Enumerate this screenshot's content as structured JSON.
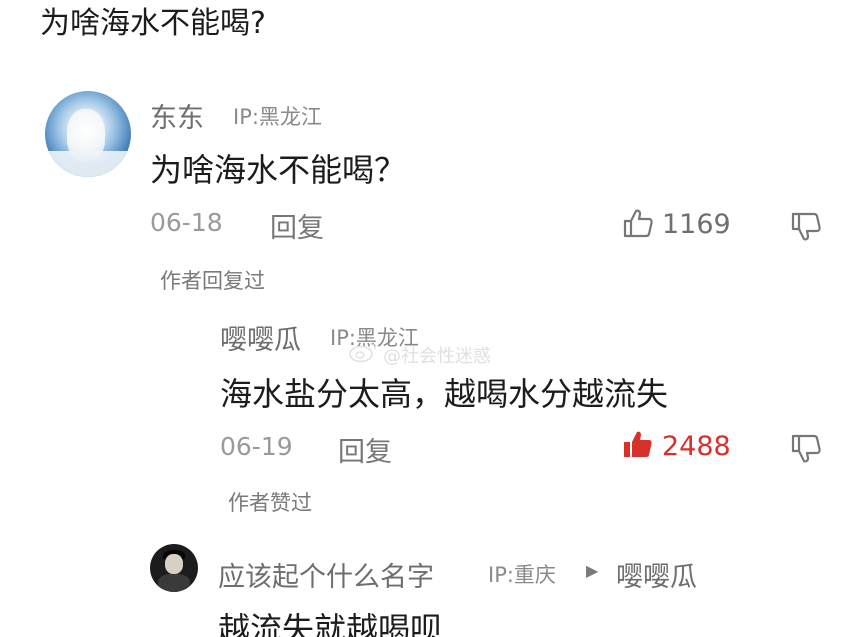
{
  "post": {
    "title": "为啥海水不能喝?"
  },
  "comments": [
    {
      "username": "东东",
      "ip": "IP:黑龙江",
      "text": "为啥海水不能喝？",
      "date": "06-18",
      "reply_label": "回复",
      "like_count": "1169",
      "liked": false,
      "author_note": "作者回复过"
    },
    {
      "username": "嘤嘤瓜",
      "ip": "IP:黑龙江",
      "text": "海水盐分太高，越喝水分越流失",
      "date": "06-19",
      "reply_label": "回复",
      "like_count": "2488",
      "liked": true,
      "author_note": "作者赞过"
    },
    {
      "username": "应该起个什么名字",
      "ip": "IP:重庆",
      "reply_to": "嘤嘤瓜",
      "text": "越流失就越喝呗"
    }
  ],
  "watermark": {
    "text": "@社会性迷惑"
  },
  "colors": {
    "liked": "#d6322c",
    "muted": "#9a9a9a",
    "text": "#1c1c1c"
  }
}
